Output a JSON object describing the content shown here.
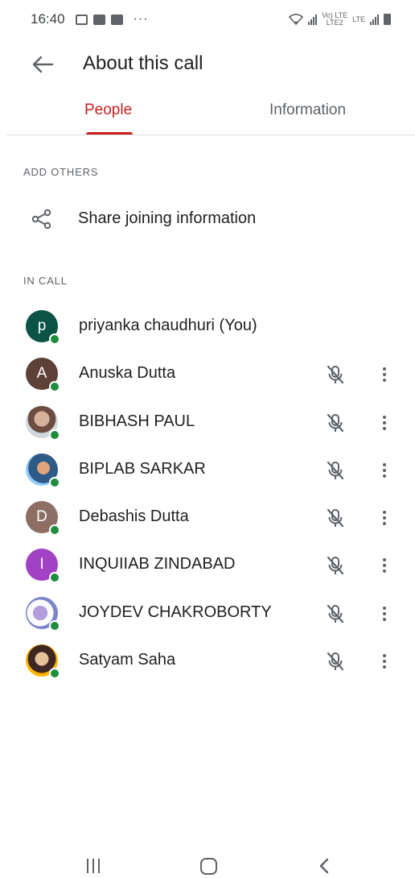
{
  "status_bar": {
    "time": "16:40",
    "overflow": "···",
    "network_label_top": "Vo) LTE",
    "network_label_bottom": "LTE2",
    "lte_label": "LTE"
  },
  "app_bar": {
    "title": "About this call",
    "back_icon": "arrow-left-icon"
  },
  "tabs": [
    {
      "label": "People",
      "active": true
    },
    {
      "label": "Information",
      "active": false
    }
  ],
  "add_others": {
    "header": "ADD OTHERS",
    "share_label": "Share joining information",
    "share_icon": "share-icon"
  },
  "in_call": {
    "header": "IN CALL",
    "participants": [
      {
        "name": "priyanka chaudhuri (You)",
        "initial": "p",
        "avatar_color": "#0b5345",
        "photo": false,
        "controls": false
      },
      {
        "name": "Anuska Dutta",
        "initial": "A",
        "avatar_color": "#5d4037",
        "photo": false,
        "controls": true
      },
      {
        "name": "BIBHASH PAUL",
        "initial": "",
        "avatar_color": "#8d6e63",
        "photo": true,
        "controls": true
      },
      {
        "name": "BIPLAB SARKAR",
        "initial": "",
        "avatar_color": "#3f7fbf",
        "photo": true,
        "controls": true
      },
      {
        "name": "Debashis Dutta",
        "initial": "D",
        "avatar_color": "#8d6e63",
        "photo": false,
        "controls": true
      },
      {
        "name": "INQUIIAB ZINDABAD",
        "initial": "I",
        "avatar_color": "#a142c4",
        "photo": false,
        "controls": true
      },
      {
        "name": "JOYDEV CHAKROBORTY",
        "initial": "",
        "avatar_color": "#9fa8da",
        "photo": true,
        "controls": true
      },
      {
        "name": "Satyam Saha",
        "initial": "",
        "avatar_color": "#4e342e",
        "photo": true,
        "controls": true
      }
    ]
  },
  "colors": {
    "accent": "#c5221f",
    "online": "#1e8e3e",
    "icon_gray": "#5f6368"
  }
}
